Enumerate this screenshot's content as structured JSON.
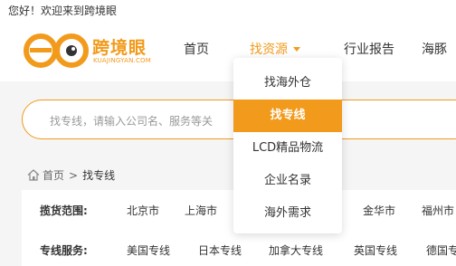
{
  "topbar": {
    "welcome": "您好！欢迎来到跨境眼"
  },
  "logo": {
    "name_cn": "跨境眼",
    "name_en": "KUAJINGYAN.COM"
  },
  "nav": {
    "home": "首页",
    "resources": "找资源",
    "report": "行业报告",
    "trade": "海豚"
  },
  "dropdown": {
    "items": [
      {
        "label": "找海外仓"
      },
      {
        "label": "找专线"
      },
      {
        "label": "LCD精品物流"
      },
      {
        "label": "企业名录"
      },
      {
        "label": "海外需求"
      }
    ],
    "active_index": 1
  },
  "search": {
    "placeholder": "找专线，请输入公司名、服务等关"
  },
  "breadcrumb": {
    "home": "首页",
    "separator": ">",
    "current": "找专线"
  },
  "filters": {
    "area": {
      "label": "揽货范围:",
      "options": [
        "北京市",
        "上海市",
        "金华市",
        "福州市"
      ]
    },
    "line": {
      "label": "专线服务:",
      "options": [
        "美国专线",
        "日本专线",
        "加拿大专线",
        "英国专线",
        "德国专"
      ]
    }
  },
  "colors": {
    "accent": "#f29a1b",
    "text": "#333333",
    "muted": "#999999"
  }
}
